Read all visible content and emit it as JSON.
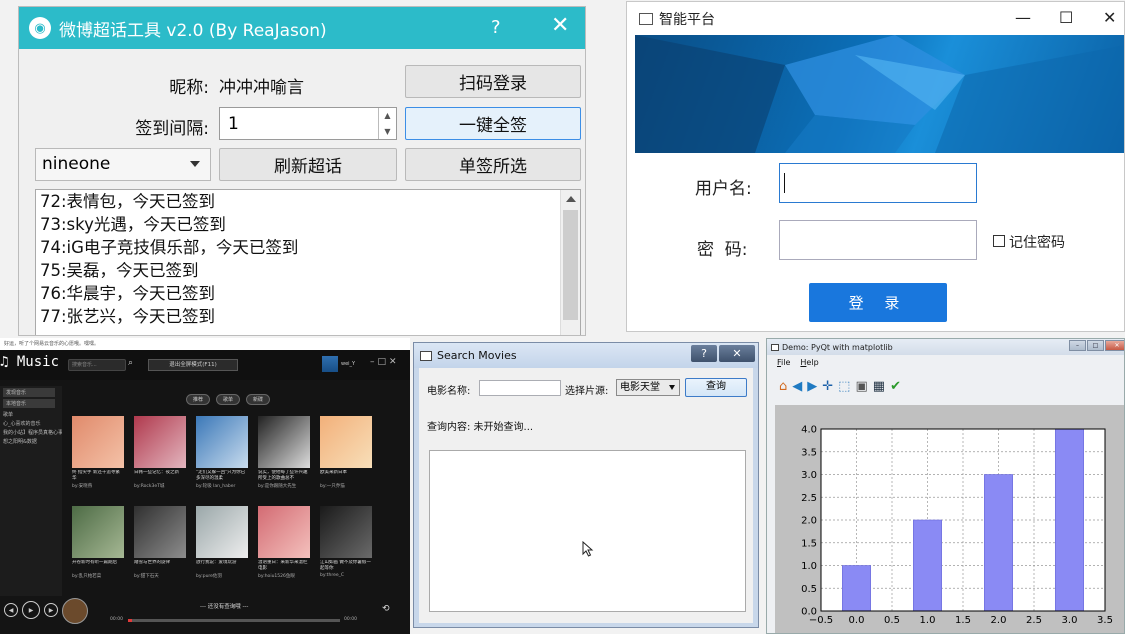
{
  "weibo": {
    "title": "微博超话工具 v2.0  (By ReaJason)",
    "help_label": "?",
    "close_label": "✕",
    "nickname_label": "昵称:",
    "nickname_value": "冲冲冲喻言",
    "scan_login_label": "扫码登录",
    "interval_label": "签到间隔:",
    "interval_value": "1",
    "sign_all_label": "一键全签",
    "account_selected": "nineone",
    "refresh_label": "刷新超话",
    "sign_selected_label": "单签所选",
    "log_lines": [
      "72:表情包，今天已签到",
      "73:sky光遇，今天已签到",
      "74:iG电子竞技俱乐部，今天已签到",
      "75:吴磊，今天已签到",
      "76:华晨宇，今天已签到",
      "77:张艺兴，今天已签到"
    ],
    "accent": "#2cbbc9"
  },
  "login": {
    "title": "智能平台",
    "username_label": "用户名:",
    "username_value": "",
    "password_label": "密  码:",
    "password_value": "",
    "remember_label": "记住密码",
    "remember_checked": false,
    "login_button": "登 录",
    "accent": "#1977dd"
  },
  "music": {
    "top_note": "好运，听了个网易云音乐的心愿哦。嘿嘿。",
    "app_name": "Music",
    "search_placeholder": "搜索音乐...",
    "mode_button": "退出全屏模式(F11)",
    "user_name": "wei_Y",
    "sidebar": [
      "发现音乐",
      "本地音乐",
      "歌单",
      "心_心喜欢的音乐",
      "我的小站】程序员真格心事",
      "想之阳明&数据"
    ],
    "tabs": [
      "推荐",
      "歌单",
      "新碟"
    ],
    "albums": [
      {
        "title": "终 指尖手 新还十追寻繁华",
        "by": "by:安晓燕",
        "color1": "#e08a6b",
        "color2": "#f4c2a8"
      },
      {
        "title": "日韩一些记忆：夜之新",
        "by": "by:Rock3eT城",
        "color1": "#b0394d",
        "color2": "#e3b6bf"
      },
      {
        "title": "\"走们又躲一回\"只为你已多深尽的温柔",
        "by": "by:轮吸 lan_haber",
        "color1": "#3b78b8",
        "color2": "#c9dcee"
      },
      {
        "title": "说实，使他每了些许兴趣所受上的歌曲总不",
        "by": "by:是你跟随大先生",
        "color1": "#222222",
        "color2": "#dddddd"
      },
      {
        "title": "欧美来新日本",
        "by": "by:一只乔猫",
        "color1": "#f2b07a",
        "color2": "#f8dfb9"
      },
      {
        "title": "开卷新时有听一篇期后",
        "by": "by:乱只帕若菜",
        "color1": "#4d6b45",
        "color2": "#a6b894"
      },
      {
        "title": "踏雪与世界的旋律",
        "by": "by:甜下石天",
        "color1": "#303030",
        "color2": "#8d8d8d"
      },
      {
        "title": "放行我说：爱境玩游",
        "by": "by:pure佐羽",
        "color1": "#9aa7a9",
        "color2": "#eeeeee"
      },
      {
        "title": "温语重日：来新华来温栏电影",
        "by": "by:hoiu1526鱼眼",
        "color1": "#d36b73",
        "color2": "#f4c1bd"
      },
      {
        "title": "江山如画 做不及你暑假一起等你",
        "by": "by:three_C",
        "color1": "#1a1a1a",
        "color2": "#6a6a6a"
      }
    ],
    "now_playing": "--- 还没有查询哦 ---",
    "time_elapsed": "00:00",
    "time_total": "00:00",
    "progress": 0.02
  },
  "movies": {
    "title": "Search Movies",
    "help_label": "?",
    "close_label": "✕",
    "name_label": "电影名称:",
    "name_value": "",
    "source_label": "选择片源:",
    "source_selected": "电影天堂",
    "query_button": "查询",
    "status_text": "查询内容: 未开始查询..."
  },
  "mpl": {
    "title": "Demo: PyQt with matplotlib",
    "menu": [
      "File",
      "Help"
    ],
    "toolbar_icons": [
      "home-icon",
      "back-icon",
      "forward-icon",
      "pan-icon",
      "zoom-icon",
      "subplots-icon",
      "save-icon",
      "check-icon"
    ]
  },
  "chart_data": {
    "type": "bar",
    "x": [
      0,
      1,
      2,
      3
    ],
    "values": [
      1,
      2,
      3,
      4
    ],
    "bar_width": 0.4,
    "xlim": [
      -0.5,
      3.5
    ],
    "ylim": [
      0,
      4
    ],
    "xticks": [
      "−0.5",
      "0.0",
      "0.5",
      "1.0",
      "1.5",
      "2.0",
      "2.5",
      "3.0",
      "3.5"
    ],
    "yticks": [
      "0.0",
      "0.5",
      "1.0",
      "1.5",
      "2.0",
      "2.5",
      "3.0",
      "3.5",
      "4.0"
    ],
    "grid": true,
    "title": "",
    "xlabel": "",
    "ylabel": "",
    "bar_color": "#8a8af4"
  }
}
